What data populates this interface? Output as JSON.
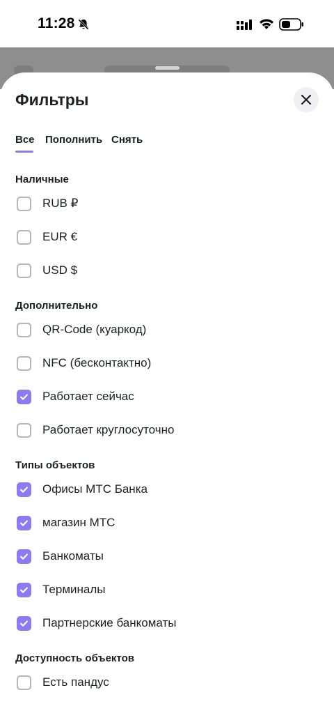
{
  "status_bar": {
    "time": "11:28",
    "icons": [
      "bell-off-icon",
      "cellular-signal-icon",
      "wifi-icon",
      "battery-icon"
    ]
  },
  "sheet": {
    "title": "Фильтры",
    "close_icon": "close-icon"
  },
  "tabs": [
    {
      "label": "Все",
      "selected": true
    },
    {
      "label": "Пополнить",
      "selected": false
    },
    {
      "label": "Снять",
      "selected": false
    }
  ],
  "sections": [
    {
      "heading": "Наличные",
      "options": [
        {
          "label": "RUB ₽",
          "checked": false
        },
        {
          "label": "EUR €",
          "checked": false
        },
        {
          "label": "USD $",
          "checked": false
        }
      ]
    },
    {
      "heading": "Дополнительно",
      "options": [
        {
          "label": "QR-Code (куаркод)",
          "checked": false
        },
        {
          "label": "NFC (бесконтактно)",
          "checked": false
        },
        {
          "label": "Работает сейчас",
          "checked": true
        },
        {
          "label": "Работает круглосуточно",
          "checked": false
        }
      ]
    },
    {
      "heading": "Типы объектов",
      "options": [
        {
          "label": "Офисы МТС Банка",
          "checked": true
        },
        {
          "label": "магазин МТС",
          "checked": true
        },
        {
          "label": "Банкоматы",
          "checked": true
        },
        {
          "label": "Терминалы",
          "checked": true
        },
        {
          "label": "Партнерские банкоматы",
          "checked": true
        }
      ]
    },
    {
      "heading": "Доступность объектов",
      "options": [
        {
          "label": "Есть пандус",
          "checked": false
        }
      ]
    }
  ],
  "colors": {
    "accent": "#8b7cf0",
    "text": "#1d2023",
    "checkbox_border": "#b3b5ba"
  }
}
